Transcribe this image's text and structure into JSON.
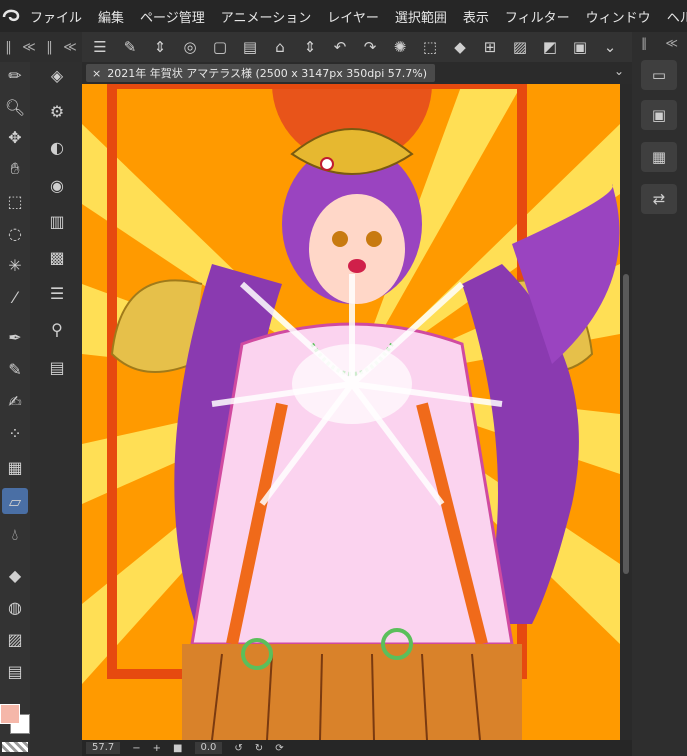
{
  "menubar": {
    "items": [
      "ファイル",
      "編集",
      "ページ管理",
      "アニメーション",
      "レイヤー",
      "選択範囲",
      "表示",
      "フィルター",
      "ウィンドウ",
      "ヘル"
    ]
  },
  "panels": {
    "left_collapse": "≪",
    "right_collapse": "≪",
    "chevron": "〉"
  },
  "document": {
    "tab_title": "2021年 年賀状 アマテラス様 (2500 x 3147px 350dpi 57.7%)",
    "close_symbol": "×"
  },
  "status": {
    "zoom": "57.7",
    "zoom_minus": "−",
    "zoom_plus": "+",
    "rotation": "0.0"
  },
  "tool_icons": [
    "brush-icon",
    "zoom-icon",
    "move-icon",
    "hand-icon",
    "transform-icon",
    "lasso-icon",
    "magic-wand-icon",
    "eyedropper-icon",
    "pen-icon",
    "pencil-icon",
    "airbrush-icon",
    "decoration-icon",
    "hatch-icon",
    "eraser-icon",
    "blend-icon",
    "fill-icon",
    "gradient-icon",
    "figure-icon",
    "frame-icon"
  ],
  "colors": {
    "canvas_background": "#ff8c00",
    "accent": "#4a6fa5"
  }
}
